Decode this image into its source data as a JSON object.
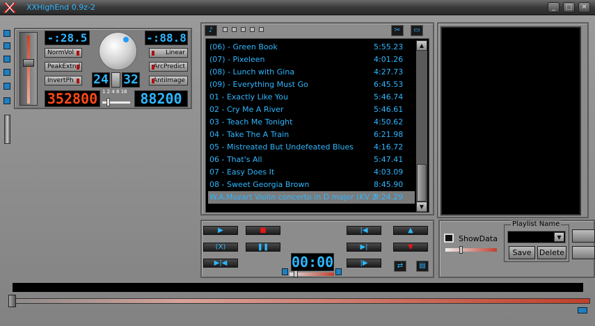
{
  "window": {
    "title": "XXHighEnd 0.9z-2"
  },
  "dsp": {
    "top_left_display": "-:28.5",
    "top_right_display": "-:88.8",
    "norm_vol": "NormVol",
    "peak_extnd": "PeakExtnd",
    "invert_ph": "InvertPh",
    "linear": "Linear",
    "arc_predict": "ArcPredict",
    "anti_image": "AntiImage",
    "bits_left": "24",
    "bits_right": "32",
    "sample_rate_in": "352800",
    "sample_rate_out": "88200",
    "ratio_labels": "1 2 4 8 16"
  },
  "playlist": {
    "rows": [
      {
        "name": "(06) - Green Book",
        "time": "5:55.23"
      },
      {
        "name": "(07) - Pixeleen",
        "time": "4:01.26"
      },
      {
        "name": "(08) - Lunch with Gina",
        "time": "4:27.73"
      },
      {
        "name": "(09) - Everything Must Go",
        "time": "6:45.53"
      },
      {
        "name": "01 - Exactly Like You",
        "time": "5:46.74"
      },
      {
        "name": "02 - Cry Me A River",
        "time": "5:46.61"
      },
      {
        "name": "03 - Teach Me Tonight",
        "time": "4:50.62"
      },
      {
        "name": "04 - Take The A Train",
        "time": "6:21.98"
      },
      {
        "name": "05 - Mistreated But Undefeated Blues",
        "time": "4:16.72"
      },
      {
        "name": "06 - That's All",
        "time": "5:47.41"
      },
      {
        "name": "07 - Easy Does It",
        "time": "4:03.09"
      },
      {
        "name": "08 - Sweet Georgia Brown",
        "time": "8:45.90"
      },
      {
        "name": "W.A.Mozart Violin concerto in D major (KV 2",
        "time": "9:24.29"
      }
    ]
  },
  "transport": {
    "time_display": "00:00"
  },
  "right_panel": {
    "show_data": "ShowData",
    "playlist_name": "Playlist Name",
    "save": "Save",
    "delete": "Delete"
  }
}
